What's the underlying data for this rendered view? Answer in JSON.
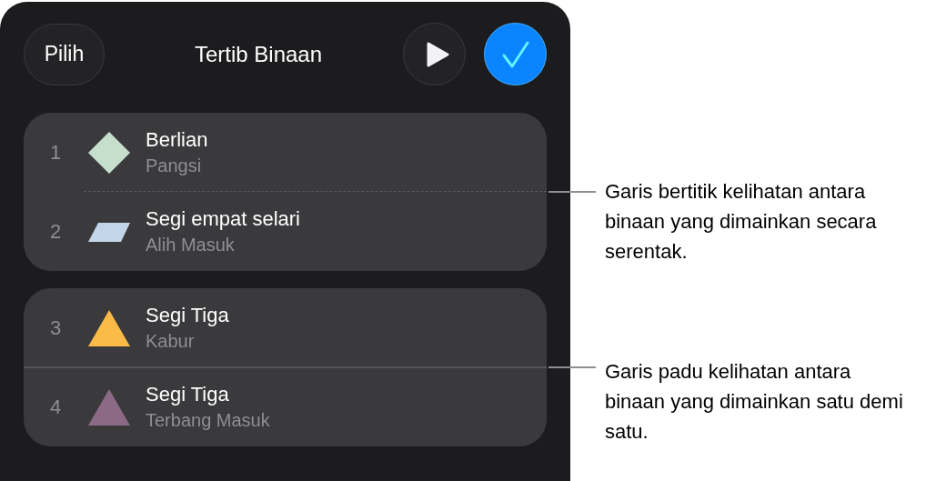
{
  "header": {
    "select_button": "Pilih",
    "title": "Tertib Binaan"
  },
  "groups": [
    {
      "simultaneous": true,
      "items": [
        {
          "number": "1",
          "kind": "diamond",
          "color": "#c6dfcc",
          "title": "Berlian",
          "effect": "Pangsi"
        },
        {
          "number": "2",
          "kind": "parallelogram",
          "color": "#c3d5e8",
          "title": "Segi empat selari",
          "effect": "Alih Masuk"
        }
      ]
    },
    {
      "simultaneous": false,
      "items": [
        {
          "number": "3",
          "kind": "triangle",
          "color": "#fbbb47",
          "title": "Segi Tiga",
          "effect": "Kabur"
        },
        {
          "number": "4",
          "kind": "triangle",
          "color": "#8c6a86",
          "title": "Segi Tiga",
          "effect": "Terbang Masuk"
        }
      ]
    }
  ],
  "callouts": [
    "Garis bertitik kelihatan antara binaan yang dimainkan secara serentak.",
    "Garis padu kelihatan antara binaan yang dimainkan satu demi satu."
  ]
}
